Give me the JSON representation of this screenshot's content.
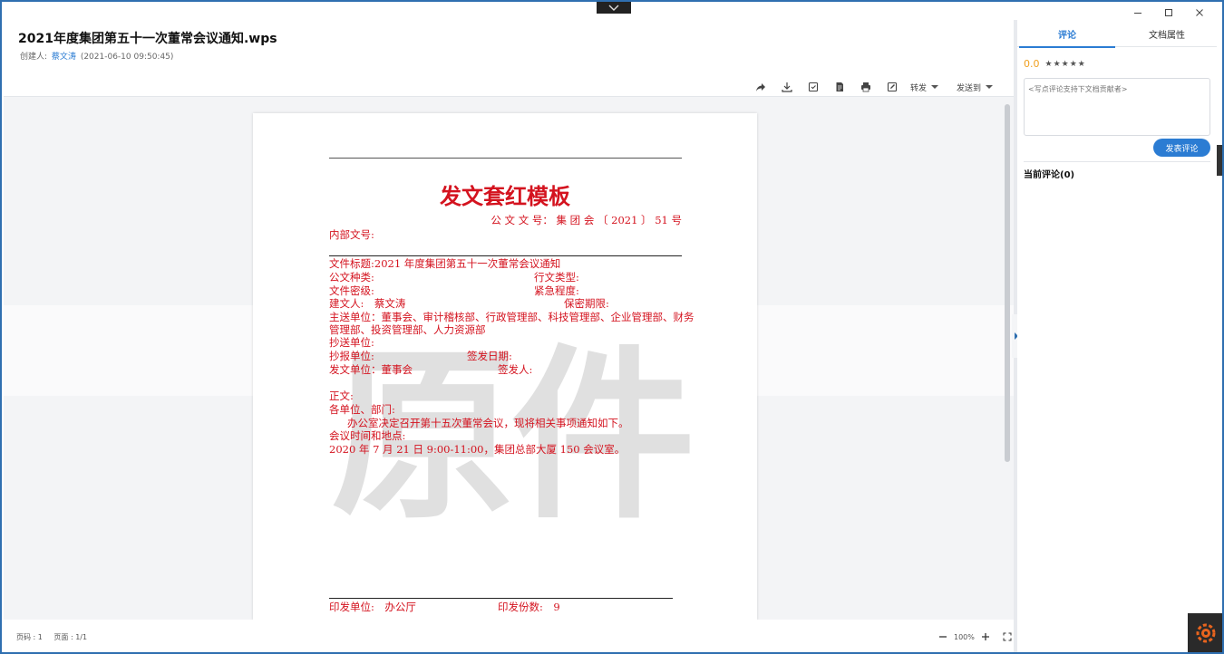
{
  "header": {
    "title": "2021年度集团第五十一次董常会议通知.wps",
    "creator_label": "创建人:",
    "creator_name": "蔡文涛",
    "created_time": "(2021-06-10 09:50:45)"
  },
  "toolbar": {
    "icons": [
      "share-icon",
      "download-icon",
      "save-icon",
      "document-icon",
      "print-icon",
      "edit-icon"
    ],
    "forward_label": "转发",
    "send_to_label": "发送到"
  },
  "document": {
    "red_title": "发文套红模板",
    "doc_number": "公 文 文 号： 集 团 会 〔 2021 〕 51 号",
    "internal_number": "内部文号:",
    "subject": "文件标题:2021 年度集团第五十一次董常会议通知",
    "doc_type": "公文种类:",
    "admin_type": "行文类型:",
    "secrecy": "文件密级:",
    "urgency": "紧急程度:",
    "drafter": "建文人:　蔡文涛",
    "retention": "保密期限:",
    "main_to_1": "主送单位：董事会、审计稽核部、行政管理部、科技管理部、企业管理部、财务",
    "main_to_2": "管理部、投资管理部、人力资源部",
    "cc_to": "抄送单位:",
    "report_to": "抄报单位:",
    "issue_date": "签发日期:",
    "issuer_unit": "发文单位：董事会",
    "signer": "签发人:",
    "body_label": "正文:",
    "salutation": "各单位、部门:",
    "body_text": "办公室决定召开第十五次董常会议，现将相关事项通知如下。",
    "meeting_label": "会议时间和地点:",
    "meeting_detail": "2020 年 7 月 21 日 9:00-11:00，集团总部大厦 150 会议室。",
    "print_unit": "印发单位:　办公厅",
    "print_copies": "印发份数:　9",
    "watermark": "原件"
  },
  "status": {
    "page_label": "页码 : 1",
    "pages_label": "页面 : 1/1",
    "zoom": "100%"
  },
  "panel": {
    "tab_comments": "评论",
    "tab_properties": "文档属性",
    "score": "0.0",
    "stars": "★★★★★",
    "comment_placeholder": "<写点评论支持下文档贡献者>",
    "post_button": "发表评论",
    "current_comments": "当前评论(0)"
  }
}
